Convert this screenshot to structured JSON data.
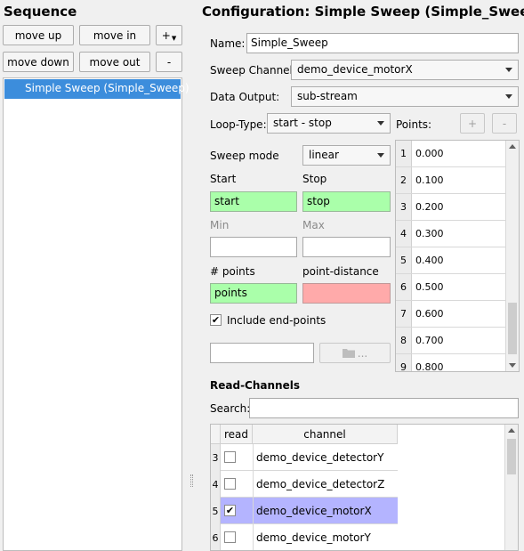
{
  "sequence": {
    "title": "Sequence",
    "buttons": {
      "move_up": "move up",
      "move_in": "move in",
      "add": "+",
      "move_down": "move down",
      "move_out": "move out",
      "remove": "-"
    },
    "items": [
      {
        "label": "Simple Sweep (Simple_Sweep)",
        "selected": true
      }
    ]
  },
  "config": {
    "title": "Configuration: Simple Sweep (Simple_Sweep)",
    "name_label": "Name:",
    "name_value": "Simple_Sweep",
    "sweep_channel_label": "Sweep Channel:",
    "sweep_channel_value": "demo_device_motorX",
    "data_output_label": "Data Output:",
    "data_output_value": "sub-stream",
    "loop_type_label": "Loop-Type:",
    "loop_type_value": "start - stop",
    "points_label": "Points:",
    "points_add": "+",
    "points_remove": "-",
    "sweep_mode_label": "Sweep mode",
    "sweep_mode_value": "linear",
    "start_label": "Start",
    "stop_label": "Stop",
    "start_value": "start",
    "stop_value": "stop",
    "min_label": "Min",
    "max_label": "Max",
    "min_value": "",
    "max_value": "",
    "num_points_label": "# points",
    "point_distance_label": "point-distance",
    "num_points_value": "points",
    "point_distance_value": "",
    "include_endpoints_label": "Include end-points",
    "include_endpoints_checked": true,
    "file_field_value": "",
    "browse_button": "...",
    "points": [
      {
        "index": "1",
        "value": "0.000"
      },
      {
        "index": "2",
        "value": "0.100"
      },
      {
        "index": "3",
        "value": "0.200"
      },
      {
        "index": "4",
        "value": "0.300"
      },
      {
        "index": "5",
        "value": "0.400"
      },
      {
        "index": "6",
        "value": "0.500"
      },
      {
        "index": "7",
        "value": "0.600"
      },
      {
        "index": "8",
        "value": "0.700"
      },
      {
        "index": "9",
        "value": "0.800"
      }
    ]
  },
  "read_channels": {
    "title": "Read-Channels",
    "search_label": "Search:",
    "search_value": "",
    "columns": {
      "read": "read",
      "channel": "channel"
    },
    "rows": [
      {
        "index": "3",
        "read": false,
        "channel": "demo_device_detectorY",
        "selected": false
      },
      {
        "index": "4",
        "read": false,
        "channel": "demo_device_detectorZ",
        "selected": false
      },
      {
        "index": "5",
        "read": true,
        "channel": "demo_device_motorX",
        "selected": true
      },
      {
        "index": "6",
        "read": false,
        "channel": "demo_device_motorY",
        "selected": false
      }
    ],
    "check_glyph": "✔"
  }
}
